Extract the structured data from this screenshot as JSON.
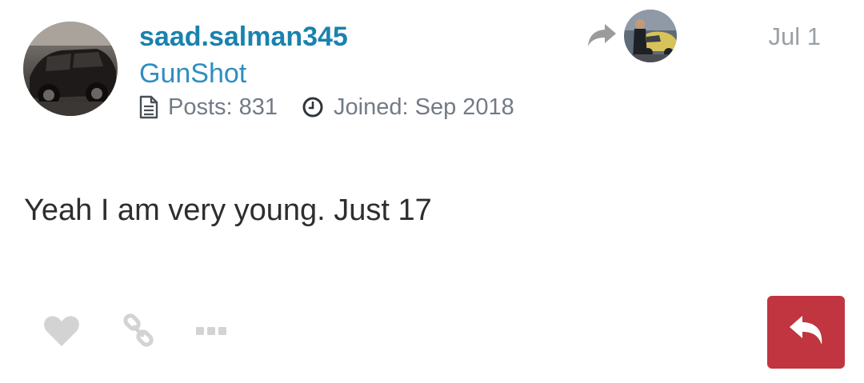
{
  "post": {
    "author": {
      "username": "saad.salman345",
      "title": "GunShot",
      "posts_label": "Posts: 831",
      "joined_label": "Joined: Sep 2018",
      "avatar_icon": "car-photo-avatar"
    },
    "reply_to": {
      "arrow_icon": "share-arrow-icon",
      "avatar_icon": "person-with-car-avatar"
    },
    "date": "Jul 1",
    "body": "Yeah I am very young. Just 17"
  },
  "actions": {
    "like_icon": "heart-icon",
    "link_icon": "link-icon",
    "more_icon": "ellipsis-icon",
    "reply_icon": "reply-arrow-icon"
  },
  "colors": {
    "username": "#1a82ae",
    "title": "#2f8ec0",
    "meta": "#727b85",
    "date": "#9aa0a6",
    "body": "#2e2e2e",
    "action_icon": "#d3d3d3",
    "reply_button": "#c0353f"
  }
}
